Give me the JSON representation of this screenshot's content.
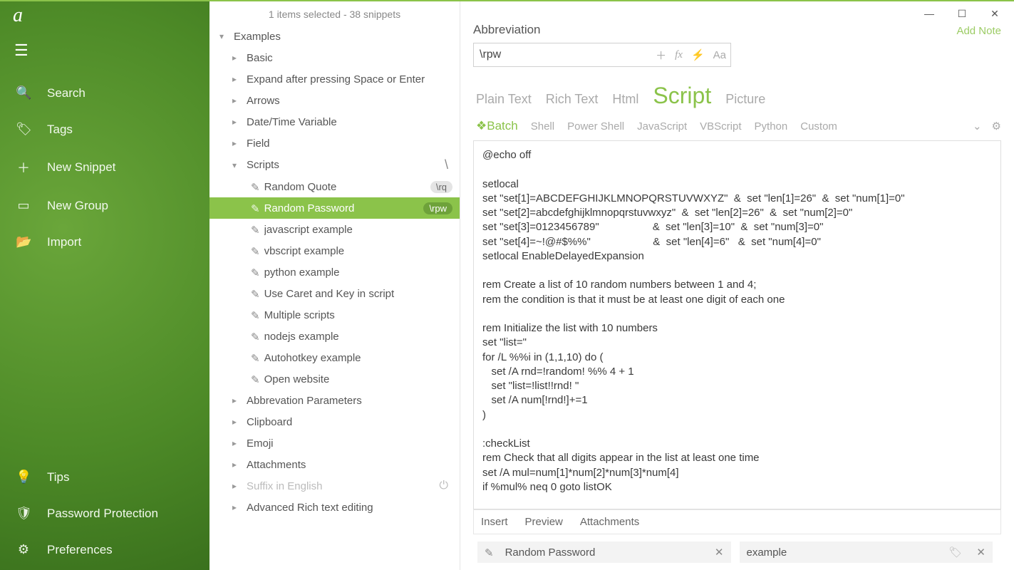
{
  "header": {
    "status": "1 items selected - 38 snippets"
  },
  "sidebar": {
    "logo": "a",
    "items": [
      {
        "icon": "🔍",
        "label": "Search"
      },
      {
        "icon": "🏷",
        "label": "Tags"
      },
      {
        "icon": "＋",
        "label": "New Snippet"
      },
      {
        "icon": "▭",
        "label": "New Group"
      },
      {
        "icon": "📂",
        "label": "Import"
      }
    ],
    "bottom": [
      {
        "icon": "💡",
        "label": "Tips"
      },
      {
        "icon": "🛡",
        "label": "Password Protection"
      },
      {
        "icon": "⚙",
        "label": "Preferences"
      }
    ]
  },
  "tree": {
    "root": "Examples",
    "groups": [
      {
        "label": "Basic"
      },
      {
        "label": "Expand after pressing Space or Enter"
      },
      {
        "label": "Arrows"
      },
      {
        "label": "Date/Time Variable"
      },
      {
        "label": "Field"
      }
    ],
    "scriptsLabel": "Scripts",
    "scriptsBadge": "\\",
    "scripts": [
      {
        "label": "Random Quote",
        "badge": "\\rq",
        "selected": false
      },
      {
        "label": "Random Password",
        "badge": "\\rpw",
        "selected": true
      },
      {
        "label": "javascript example"
      },
      {
        "label": "vbscript example"
      },
      {
        "label": "python example"
      },
      {
        "label": "Use Caret and Key in script"
      },
      {
        "label": "Multiple scripts"
      },
      {
        "label": "nodejs example"
      },
      {
        "label": "Autohotkey example"
      },
      {
        "label": "Open website"
      }
    ],
    "after": [
      {
        "label": "Abbrevation Parameters"
      },
      {
        "label": "Clipboard"
      },
      {
        "label": "Emoji"
      },
      {
        "label": "Attachments"
      },
      {
        "label": "Suffix in English",
        "muted": true,
        "power": true
      },
      {
        "label": "Advanced Rich text editing"
      }
    ]
  },
  "detail": {
    "abbrLabel": "Abbreviation",
    "addNote": "Add Note",
    "abbrValue": "\\rpw",
    "typeTabs": [
      "Plain Text",
      "Rich Text",
      "Html",
      "Script",
      "Picture"
    ],
    "typeActive": "Script",
    "langTabs": [
      "Batch",
      "Shell",
      "Power Shell",
      "JavaScript",
      "VBScript",
      "Python",
      "Custom"
    ],
    "langActive": "Batch",
    "code": "@echo off\n\nsetlocal\nset \"set[1]=ABCDEFGHIJKLMNOPQRSTUVWXYZ\"  &  set \"len[1]=26\"  &  set \"num[1]=0\"\nset \"set[2]=abcdefghijklmnopqrstuvwxyz\"  &  set \"len[2]=26\"  &  set \"num[2]=0\"\nset \"set[3]=0123456789\"                  &  set \"len[3]=10\"  &  set \"num[3]=0\"\nset \"set[4]=~!@#$%%\"                     &  set \"len[4]=6\"   &  set \"num[4]=0\"\nsetlocal EnableDelayedExpansion\n\nrem Create a list of 10 random numbers between 1 and 4;\nrem the condition is that it must be at least one digit of each one\n\nrem Initialize the list with 10 numbers\nset \"list=\"\nfor /L %%i in (1,1,10) do (\n   set /A rnd=!random! %% 4 + 1\n   set \"list=!list!!rnd! \"\n   set /A num[!rnd!]+=1\n)\n\n:checkList\nrem Check that all digits appear in the list at least one time\nset /A mul=num[1]*num[2]*num[3]*num[4]\nif %mul% neq 0 goto listOK\n\n   rem Change elements in the list until fulfill the condition",
    "bottomActions": [
      "Insert",
      "Preview",
      "Attachments"
    ],
    "snippetTitle": "Random Password",
    "tagValue": "example"
  }
}
